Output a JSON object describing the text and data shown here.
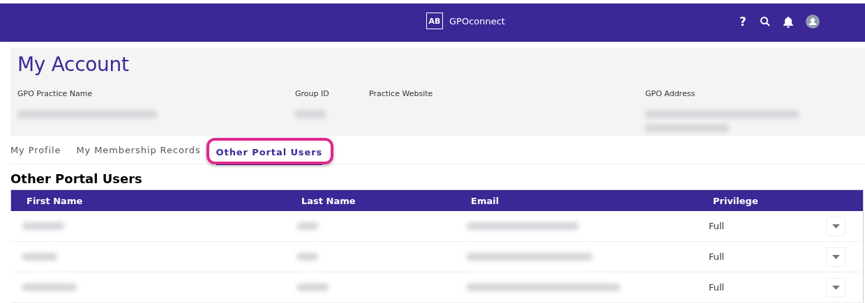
{
  "header": {
    "logo_mark": "AB",
    "brand": "GPOconnect",
    "help": "?"
  },
  "account": {
    "title": "My Account",
    "fields": [
      {
        "label": "GPO Practice Name",
        "redacted": true
      },
      {
        "label": "Group ID",
        "redacted": true
      },
      {
        "label": "Practice Website",
        "redacted": false
      },
      {
        "label": "GPO Address",
        "redacted": true
      }
    ]
  },
  "tabs": [
    {
      "label": "My Profile",
      "selected": false,
      "highlighted": false
    },
    {
      "label": "My Membership Records",
      "selected": false,
      "highlighted": false
    },
    {
      "label": "Other Portal Users",
      "selected": true,
      "highlighted": true
    }
  ],
  "section_title": "Other Portal Users",
  "table": {
    "columns": [
      "First Name",
      "Last Name",
      "Email",
      "Privilege"
    ],
    "rows": [
      {
        "first_name": {
          "redacted": true
        },
        "last_name": {
          "redacted": true
        },
        "email": {
          "redacted": true
        },
        "privilege": "Full"
      },
      {
        "first_name": {
          "redacted": true
        },
        "last_name": {
          "redacted": true
        },
        "email": {
          "redacted": true
        },
        "privilege": "Full"
      },
      {
        "first_name": {
          "redacted": true
        },
        "last_name": {
          "redacted": true
        },
        "email": {
          "redacted": true
        },
        "privilege": "Full"
      }
    ]
  }
}
